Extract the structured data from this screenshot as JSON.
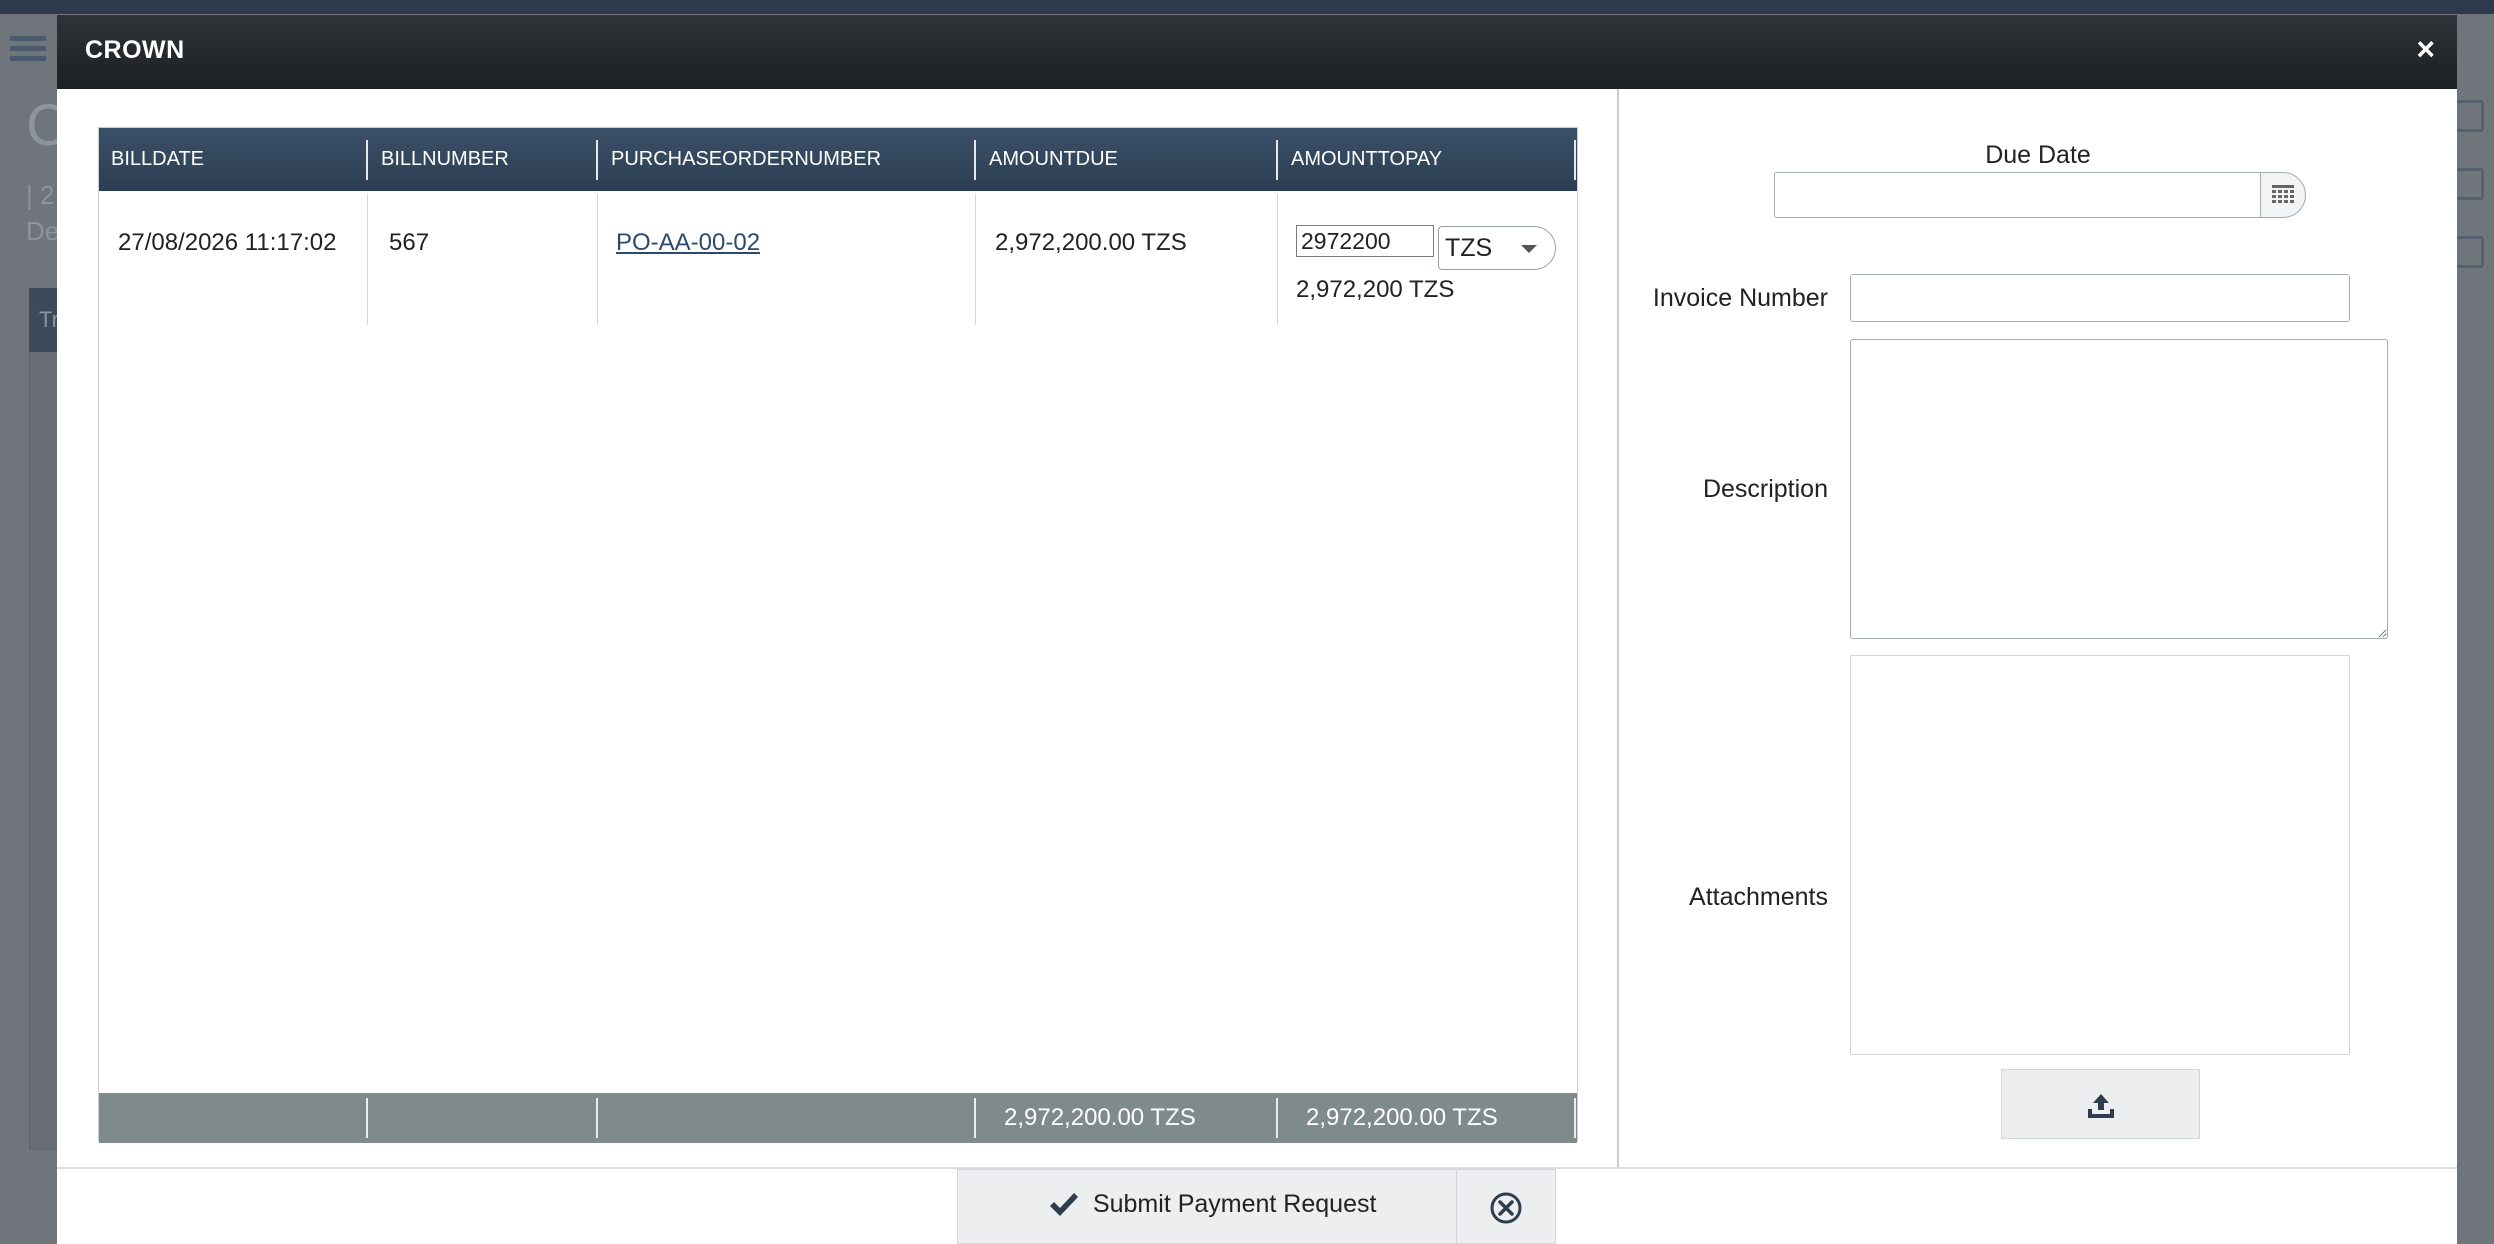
{
  "background": {
    "page_letter": "C",
    "page_sub1": "| 2",
    "page_sub2": "De",
    "panel_head": "Tr"
  },
  "modal": {
    "title": "CROWN",
    "close_label": "×"
  },
  "grid": {
    "columns": [
      "BILLDATE",
      "BILLNUMBER",
      "PURCHASEORDERNUMBER",
      "AMOUNTDUE",
      "AMOUNTTOPAY"
    ],
    "rows": [
      {
        "billdate": "27/08/2026 11:17:02",
        "billnumber": "567",
        "purchaseordernumber": "PO-AA-00-02",
        "amountdue": "2,972,200.00 TZS",
        "amounttopay_input": "2972200",
        "amounttopay_currency": "TZS",
        "amounttopay_display": "2,972,200 TZS"
      }
    ],
    "totals": {
      "amountdue": "2,972,200.00 TZS",
      "amounttopay": "2,972,200.00 TZS"
    }
  },
  "form": {
    "due_date_label": "Due Date",
    "due_date_value": "",
    "invoice_number_label": "Invoice Number",
    "invoice_number_value": "",
    "description_label": "Description",
    "description_value": "",
    "attachments_label": "Attachments"
  },
  "actions": {
    "submit_label": "Submit Payment Request"
  },
  "icons": {
    "close": "close-icon",
    "calendar": "calendar-icon",
    "upload": "upload-icon",
    "submit": "check-icon",
    "cancel": "cancel-circle-icon",
    "menu": "hamburger-menu-icon"
  }
}
